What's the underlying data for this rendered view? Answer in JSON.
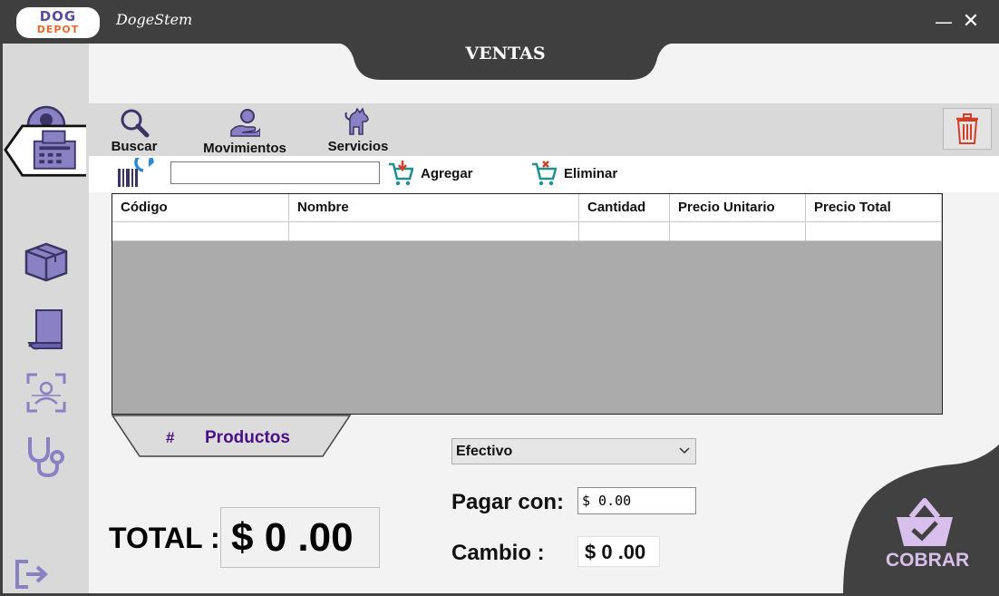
{
  "window": {
    "app_title": "DogeStem",
    "logo_top": "DOG",
    "logo_bottom": "DEPOT",
    "minimize_symbol": "—",
    "close_symbol": "✕"
  },
  "header": {
    "title": "VENTAS"
  },
  "sidebar": {
    "items": [
      {
        "icon": "user-icon"
      },
      {
        "icon": "cash-register-icon",
        "active": true
      },
      {
        "icon": "box-icon"
      },
      {
        "icon": "book-icon"
      },
      {
        "icon": "employee-scan-icon"
      },
      {
        "icon": "stethoscope-icon"
      }
    ],
    "logout_icon": "logout-icon"
  },
  "toolbar": {
    "buscar_label": "Buscar",
    "movimientos_label": "Movimientos",
    "servicios_label": "Servicios"
  },
  "entry": {
    "code_value": "",
    "agregar_label": "Agregar",
    "eliminar_label": "Eliminar"
  },
  "table": {
    "columns": [
      "Código",
      "Nombre",
      "Cantidad",
      "Precio Unitario",
      "Precio Total"
    ],
    "rows": [
      [
        "",
        "",
        "",
        "",
        ""
      ]
    ]
  },
  "products": {
    "hash": "#",
    "label": "Productos"
  },
  "payment": {
    "method_selected": "Efectivo",
    "pagar_label": "Pagar con:",
    "pagar_value": "$ 0.00",
    "cambio_label": "Cambio :",
    "cambio_value": "$ 0 .00"
  },
  "total": {
    "label": "TOTAL :",
    "value": "$ 0 .00"
  },
  "cobrar": {
    "label": "COBRAR"
  },
  "colors": {
    "titlebar": "#3f3f3f",
    "sidebar": "#d9d9d9",
    "accent_purple": "#8a80c4",
    "cobrar_text": "#d9c0ec",
    "products_text": "#4b0f85",
    "trash_red": "#d0402a",
    "cart_teal": "#1f8f8f"
  }
}
